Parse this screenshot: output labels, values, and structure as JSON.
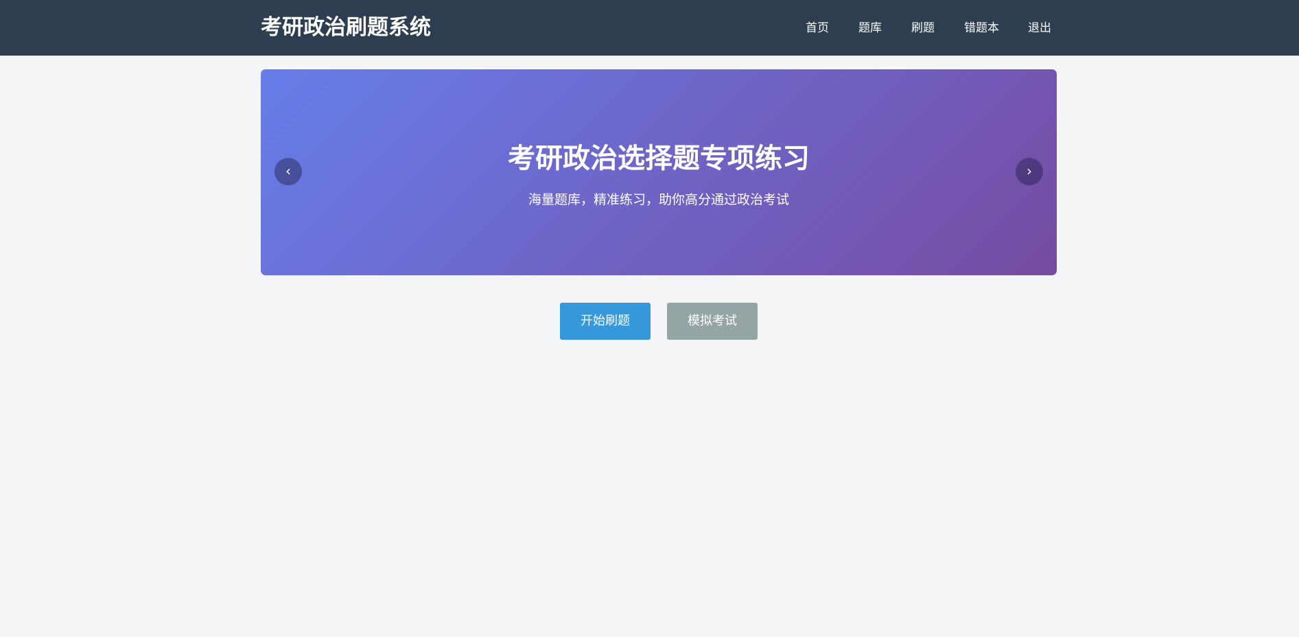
{
  "header": {
    "brand": "考研政治刷题系统",
    "nav": {
      "home": "首页",
      "bank": "题库",
      "practice": "刷题",
      "wrong": "错题本",
      "logout": "退出"
    }
  },
  "banner": {
    "title": "考研政治选择题专项练习",
    "subtitle": "海量题库，精准练习，助你高分通过政治考试",
    "prev_glyph": "‹",
    "next_glyph": "›"
  },
  "actions": {
    "start": "开始刷题",
    "mock": "模拟考试"
  },
  "colors": {
    "header_bg": "#2c3e50",
    "banner_gradient_start": "#667eea",
    "banner_gradient_end": "#764ba2",
    "primary_button": "#3498db",
    "secondary_button": "#95a5a6",
    "page_bg": "#f4f5f6"
  }
}
